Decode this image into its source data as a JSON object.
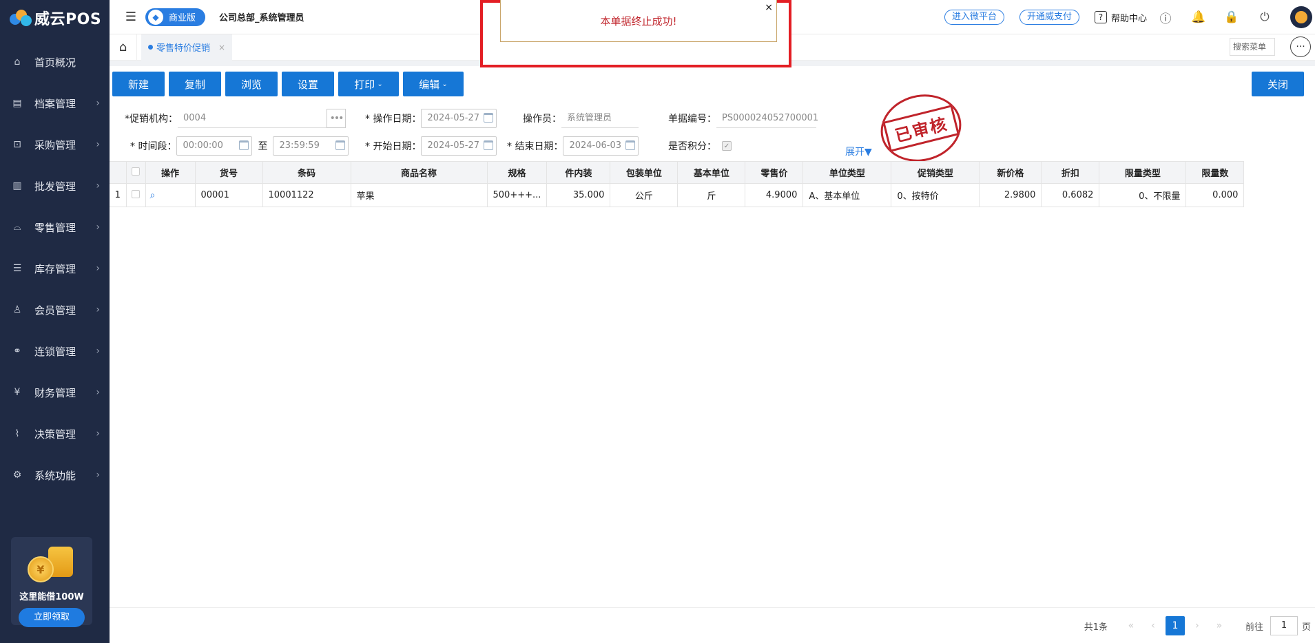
{
  "app": {
    "logo_text": "威云POS",
    "edition": "商业版",
    "company": "公司总部_系统管理员"
  },
  "sidebar": {
    "items": [
      {
        "label": "首页概况",
        "icon": "home-icon",
        "glyph": "⌂",
        "chev": ""
      },
      {
        "label": "档案管理",
        "icon": "archive-icon",
        "glyph": "▤",
        "chev": "›"
      },
      {
        "label": "采购管理",
        "icon": "cart-icon",
        "glyph": "⊡",
        "chev": "›"
      },
      {
        "label": "批发管理",
        "icon": "building-icon",
        "glyph": "▥",
        "chev": "›"
      },
      {
        "label": "零售管理",
        "icon": "store-icon",
        "glyph": "⌓",
        "chev": "›"
      },
      {
        "label": "库存管理",
        "icon": "inventory-icon",
        "glyph": "☰",
        "chev": "›"
      },
      {
        "label": "会员管理",
        "icon": "member-icon",
        "glyph": "♙",
        "chev": "›"
      },
      {
        "label": "连锁管理",
        "icon": "chain-icon",
        "glyph": "⚭",
        "chev": "›"
      },
      {
        "label": "财务管理",
        "icon": "finance-icon",
        "glyph": "¥",
        "chev": "›"
      },
      {
        "label": "决策管理",
        "icon": "chart-icon",
        "glyph": "⌇",
        "chev": "›"
      },
      {
        "label": "系统功能",
        "icon": "gear-icon",
        "glyph": "⚙",
        "chev": "›"
      }
    ],
    "promo": {
      "text": "这里能借100W",
      "button": "立即领取",
      "coin": "¥"
    }
  },
  "header": {
    "wechat_platform": "进入微平台",
    "open_pay": "开通威支付",
    "help": "帮助中心",
    "help_glyph": "?",
    "icons": [
      {
        "name": "info-icon",
        "glyph": "ⓘ"
      },
      {
        "name": "bell-icon",
        "glyph": "🔔"
      },
      {
        "name": "lock-icon",
        "glyph": "🔒"
      },
      {
        "name": "power-icon",
        "glyph": "⏻"
      }
    ]
  },
  "tabs": {
    "active": "零售特价促销",
    "close": "×",
    "search_menu": "搜索菜单",
    "more": "···",
    "home_glyph": "⌂"
  },
  "toolbar": {
    "new": "新建",
    "copy": "复制",
    "browse": "浏览",
    "settings": "设置",
    "print": "打印",
    "edit": "编辑",
    "close": "关闭"
  },
  "form": {
    "org_label": "*促销机构：",
    "org_value": "0004",
    "op_date_label": "* 操作日期：",
    "op_date_value": "2024-05-27",
    "operator_label": "操作员：",
    "operator_value": "系统管理员",
    "doc_no_label": "单据编号：",
    "doc_no_value": "PS000024052700001",
    "period_label": "* 时间段：",
    "period_start": "00:00:00",
    "period_to": "至",
    "period_end": "23:59:59",
    "start_date_label": "* 开始日期：",
    "start_date_value": "2024-05-27",
    "end_date_label": "* 结束日期：",
    "end_date_value": "2024-06-03",
    "points_label": "是否积分：",
    "points_check": "✓",
    "expand": "展开▼",
    "stamp": "已审核"
  },
  "table": {
    "headers": [
      "",
      "操作",
      "货号",
      "条码",
      "商品名称",
      "规格",
      "件内装",
      "包装单位",
      "基本单位",
      "零售价",
      "单位类型",
      "促销类型",
      "新价格",
      "折扣",
      "限量类型",
      "限量数"
    ],
    "rows": [
      {
        "idx": "1",
        "sku": "00001",
        "barcode": "10001122",
        "name": "苹果",
        "spec": "500+++...",
        "pack_qty": "35.000",
        "pack_unit": "公斤",
        "base_unit": "斤",
        "retail_price": "4.9000",
        "unit_type": "A、基本单位",
        "promo_type": "0、按特价",
        "new_price": "2.9800",
        "discount": "0.6082",
        "limit_type": "0、不限量",
        "limit_qty": "0.000"
      }
    ]
  },
  "pager": {
    "total": "共1条",
    "current": "1",
    "goto_label": "前往",
    "goto_value": "1",
    "page_unit": "页"
  },
  "toast": {
    "message": "本单据终止成功!",
    "close": "×"
  },
  "colors": {
    "primary": "#1677d6",
    "sidebar": "#1f2a44",
    "alert": "#e31e24"
  }
}
